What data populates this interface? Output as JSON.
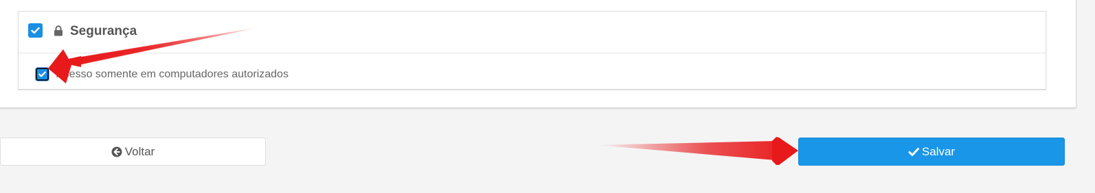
{
  "security_card": {
    "title": "Segurança",
    "enabled": true,
    "icon": "lock-icon",
    "options": [
      {
        "label": "Acesso somente em computadores autorizados",
        "checked": true
      }
    ]
  },
  "actions": {
    "back_label": "Voltar",
    "back_icon": "circle-arrow-left-icon",
    "save_label": "Salvar",
    "save_icon": "check-icon"
  },
  "colors": {
    "accent": "#1a96e8",
    "annotation": "#e8191b"
  }
}
